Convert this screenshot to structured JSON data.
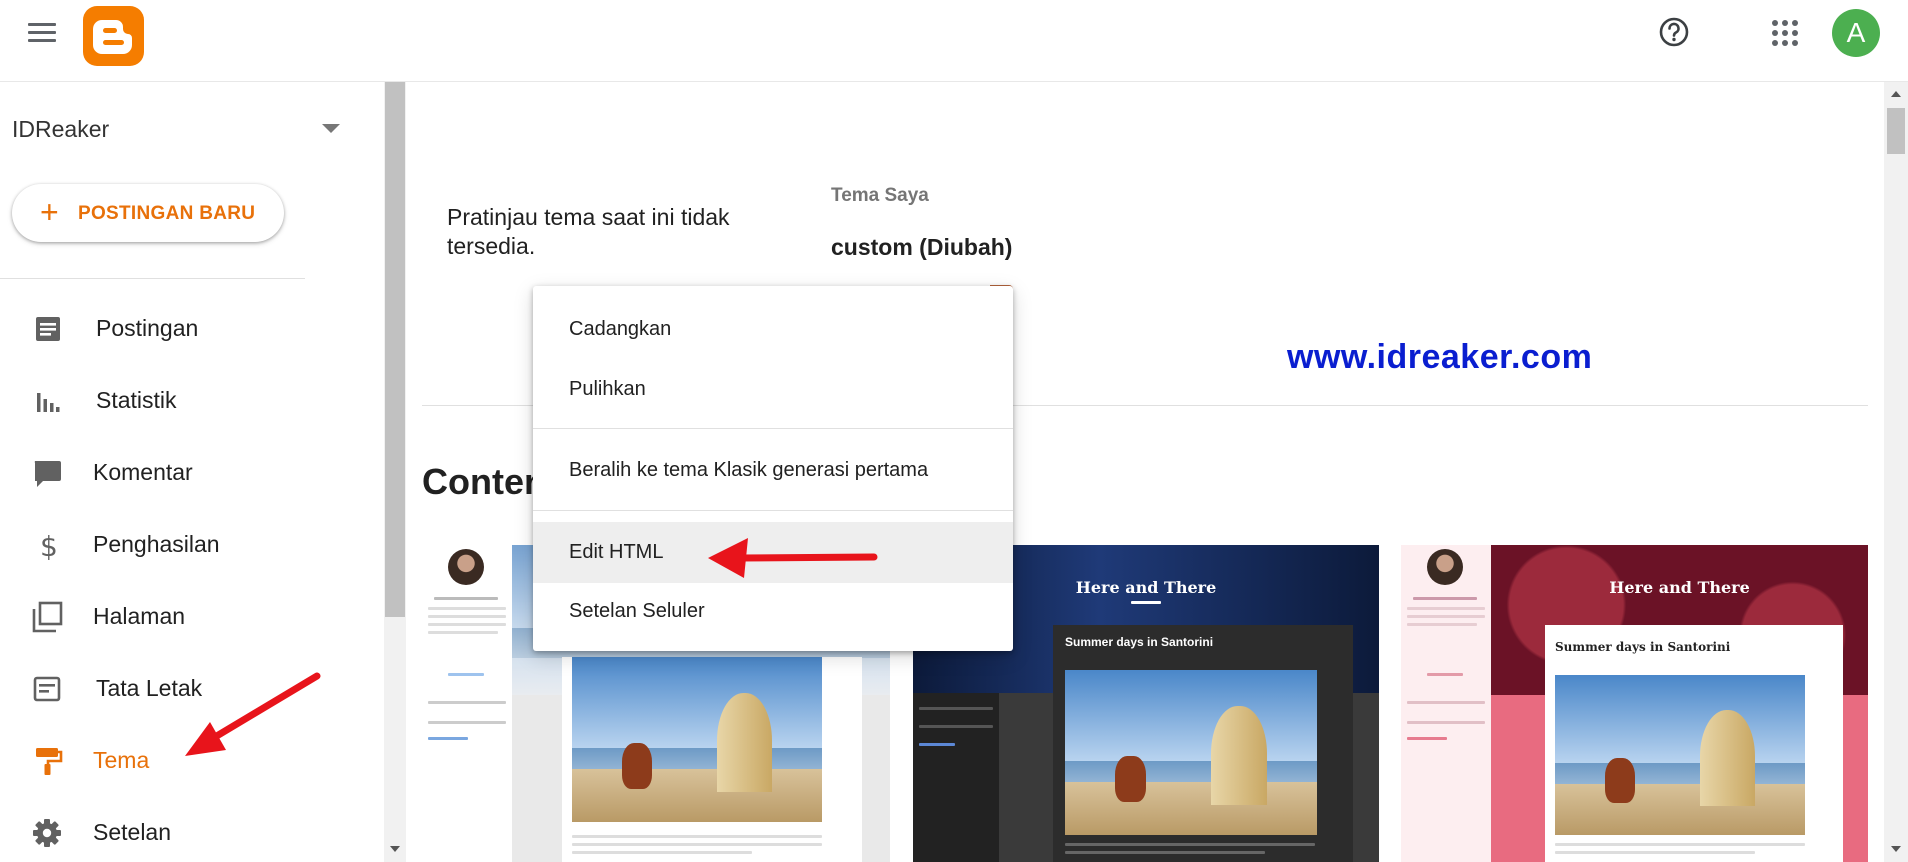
{
  "header": {
    "avatar_letter": "A",
    "colors": {
      "brand": "#f57d00",
      "avatar": "#4caf50"
    },
    "icons": [
      "menu-icon",
      "blogger-logo",
      "help-icon",
      "apps-icon"
    ]
  },
  "sidebar": {
    "blog_name": "IDReaker",
    "new_post_label": "POSTINGAN BARU",
    "items": [
      {
        "label": "Postingan",
        "icon": "posts-icon"
      },
      {
        "label": "Statistik",
        "icon": "stats-icon"
      },
      {
        "label": "Komentar",
        "icon": "comments-icon"
      },
      {
        "label": "Penghasilan",
        "icon": "dollar-icon"
      },
      {
        "label": "Halaman",
        "icon": "pages-icon"
      },
      {
        "label": "Tata Letak",
        "icon": "layout-icon"
      },
      {
        "label": "Tema",
        "icon": "paint-roller-icon",
        "active": true
      },
      {
        "label": "Setelan",
        "icon": "gear-icon"
      }
    ],
    "active_color": "#e8710a"
  },
  "main": {
    "preview_text": "Pratinjau tema saat ini tidak tersedia.",
    "my_theme_label": "Tema Saya",
    "theme_name": "custom (Diubah)",
    "watermark": "www.idreaker.com",
    "section_title": "Conten",
    "cards": [
      {
        "hero_title": "",
        "post_title": ""
      },
      {
        "hero_title": "Here and There",
        "post_title": "Summer days in Santorini"
      },
      {
        "hero_title": "Here and There",
        "post_title": "Summer days in Santorini"
      }
    ]
  },
  "dropdown": {
    "items": [
      {
        "label": "Cadangkan"
      },
      {
        "label": "Pulihkan"
      },
      {
        "label": "Beralih ke tema Klasik generasi pertama"
      },
      {
        "label": "Edit HTML",
        "highlighted": true
      },
      {
        "label": "Setelan Seluler"
      }
    ]
  },
  "annotations": {
    "arrow_color": "#e8141b"
  }
}
